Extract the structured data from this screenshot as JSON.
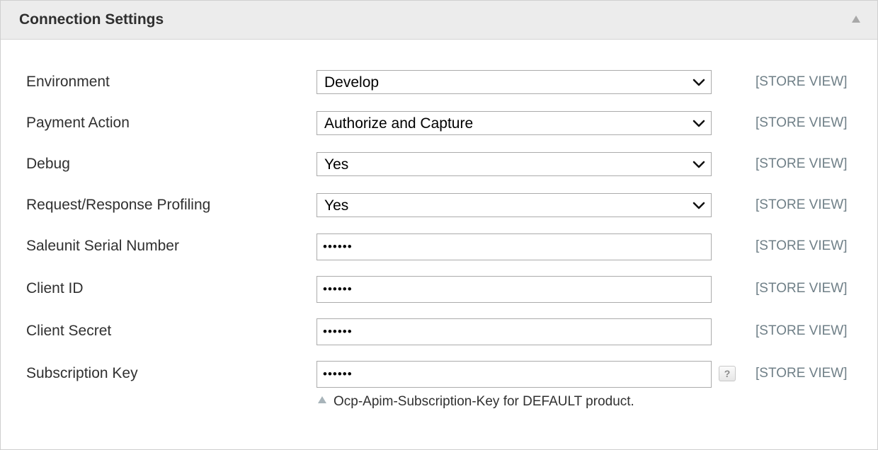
{
  "panel": {
    "title": "Connection Settings"
  },
  "fields": {
    "environment": {
      "label": "Environment",
      "value": "Develop",
      "scope": "[STORE VIEW]"
    },
    "payment_action": {
      "label": "Payment Action",
      "value": "Authorize and Capture",
      "scope": "[STORE VIEW]"
    },
    "debug": {
      "label": "Debug",
      "value": "Yes",
      "scope": "[STORE VIEW]"
    },
    "profiling": {
      "label": "Request/Response Profiling",
      "value": "Yes",
      "scope": "[STORE VIEW]"
    },
    "serial_number": {
      "label": "Saleunit Serial Number",
      "value": "••••••",
      "scope": "[STORE VIEW]"
    },
    "client_id": {
      "label": "Client ID",
      "value": "••••••",
      "scope": "[STORE VIEW]"
    },
    "client_secret": {
      "label": "Client Secret",
      "value": "••••••",
      "scope": "[STORE VIEW]"
    },
    "subscription_key": {
      "label": "Subscription Key",
      "value": "••••••",
      "scope": "[STORE VIEW]",
      "help": "?",
      "note": "Ocp-Apim-Subscription-Key for DEFAULT product."
    }
  },
  "colors": {
    "scope_text": "#6f7f87",
    "header_bg": "#ececec",
    "border": "#ababab"
  }
}
